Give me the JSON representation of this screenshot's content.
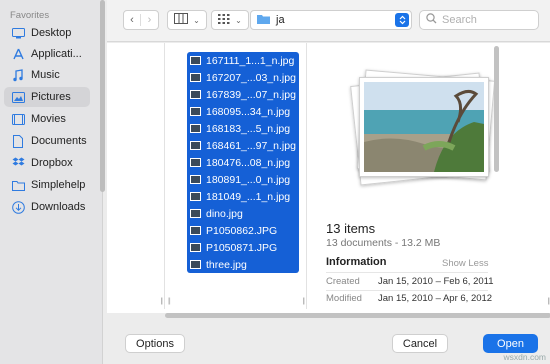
{
  "sidebar": {
    "heading": "Favorites",
    "items": [
      {
        "label": "Desktop",
        "icon": "desktop-icon"
      },
      {
        "label": "Applicati...",
        "icon": "applications-icon"
      },
      {
        "label": "Music",
        "icon": "music-icon"
      },
      {
        "label": "Pictures",
        "icon": "pictures-icon",
        "selected": true
      },
      {
        "label": "Movies",
        "icon": "movies-icon"
      },
      {
        "label": "Documents",
        "icon": "documents-icon"
      },
      {
        "label": "Dropbox",
        "icon": "dropbox-icon"
      },
      {
        "label": "Simplehelp",
        "icon": "folder-icon"
      },
      {
        "label": "Downloads",
        "icon": "downloads-icon"
      }
    ]
  },
  "toolbar": {
    "location_label": "ja",
    "search_placeholder": "Search"
  },
  "files": [
    "167111_1...1_n.jpg",
    "167207_...03_n.jpg",
    "167839_...07_n.jpg",
    "168095...34_n.jpg",
    "168183_...5_n.jpg",
    "168461_...97_n.jpg",
    "180476...08_n.jpg",
    "180891_...0_n.jpg",
    "181049_...1_n.jpg",
    "dino.jpg",
    "P1050862.JPG",
    "P1050871.JPG",
    "three.jpg"
  ],
  "preview": {
    "title": "13 items",
    "subtitle": "13 documents - 13.2 MB",
    "info_heading": "Information",
    "show_less": "Show Less",
    "created_label": "Created",
    "created_value": "Jan 15, 2010 – Feb 6, 2011",
    "modified_label": "Modified",
    "modified_value": "Jan 15, 2010 – Apr 6, 2012"
  },
  "footer": {
    "options_label": "Options",
    "cancel_label": "Cancel",
    "open_label": "Open"
  },
  "watermark": "wsxdn.com",
  "colors": {
    "accent": "#1a73e8",
    "selection": "#1560d6"
  }
}
